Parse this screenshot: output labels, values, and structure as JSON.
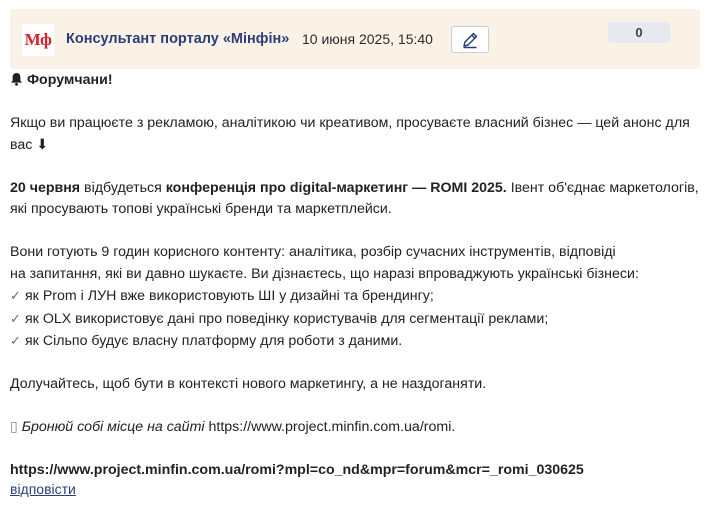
{
  "header": {
    "avatar_text": "Мф",
    "author": "Консультант порталу «Мінфін»",
    "date": "10 июня 2025, 15:40",
    "rating": "0",
    "icons": {
      "edit": "pencil-icon"
    }
  },
  "body": {
    "greeting": "Форумчани!",
    "intro": "Якщо ви працюєте з рекламою, аналітикою чи креативом, просуваєте власний бізнес — цей анонс для вас",
    "intro_arrow": "⬇",
    "event_date": "20 червня",
    "event_mid": " відбудеться ",
    "event_name": "конференція про digital-маркетинг — ROMI 2025.",
    "event_rest": " Івент об'єднає маркетологів, які просувають топові українські бренди та маркетплейси.",
    "content_line1": "Вони готують 9 годин корисного контенту: аналітика, розбір сучасних інструментів, відповіді",
    "content_line2": "на запитання, які ви давно шукаєте. Ви дізнаєтесь, що наразі впроваджують українські бізнеси:",
    "check_mark": "✓",
    "bullets": [
      "як Prom і ЛУН вже використовують ШІ у дизайні та брендингу;",
      "як OLX використовує дані про поведінку користувачів для сегментації реклами;",
      "як Сільпо будує власну платформу для роботи з даними."
    ],
    "cta": "Долучайтесь, щоб бути в контексті нового маркетингу, а не наздоганяти.",
    "book_glyph": "▯",
    "book_text": "Бронюй собі місце на сайті",
    "book_url": " https://www.project.minfin.com.ua/romi.",
    "tracking_url": "https://www.project.minfin.com.ua/romi?mpl=co_nd&mpr=forum&mcr=_romi_030625"
  },
  "footer": {
    "reply": "відповісти"
  },
  "colors": {
    "header_bg": "#fbf2e7",
    "author": "#2a3e7a",
    "logo_red": "#d62027"
  }
}
